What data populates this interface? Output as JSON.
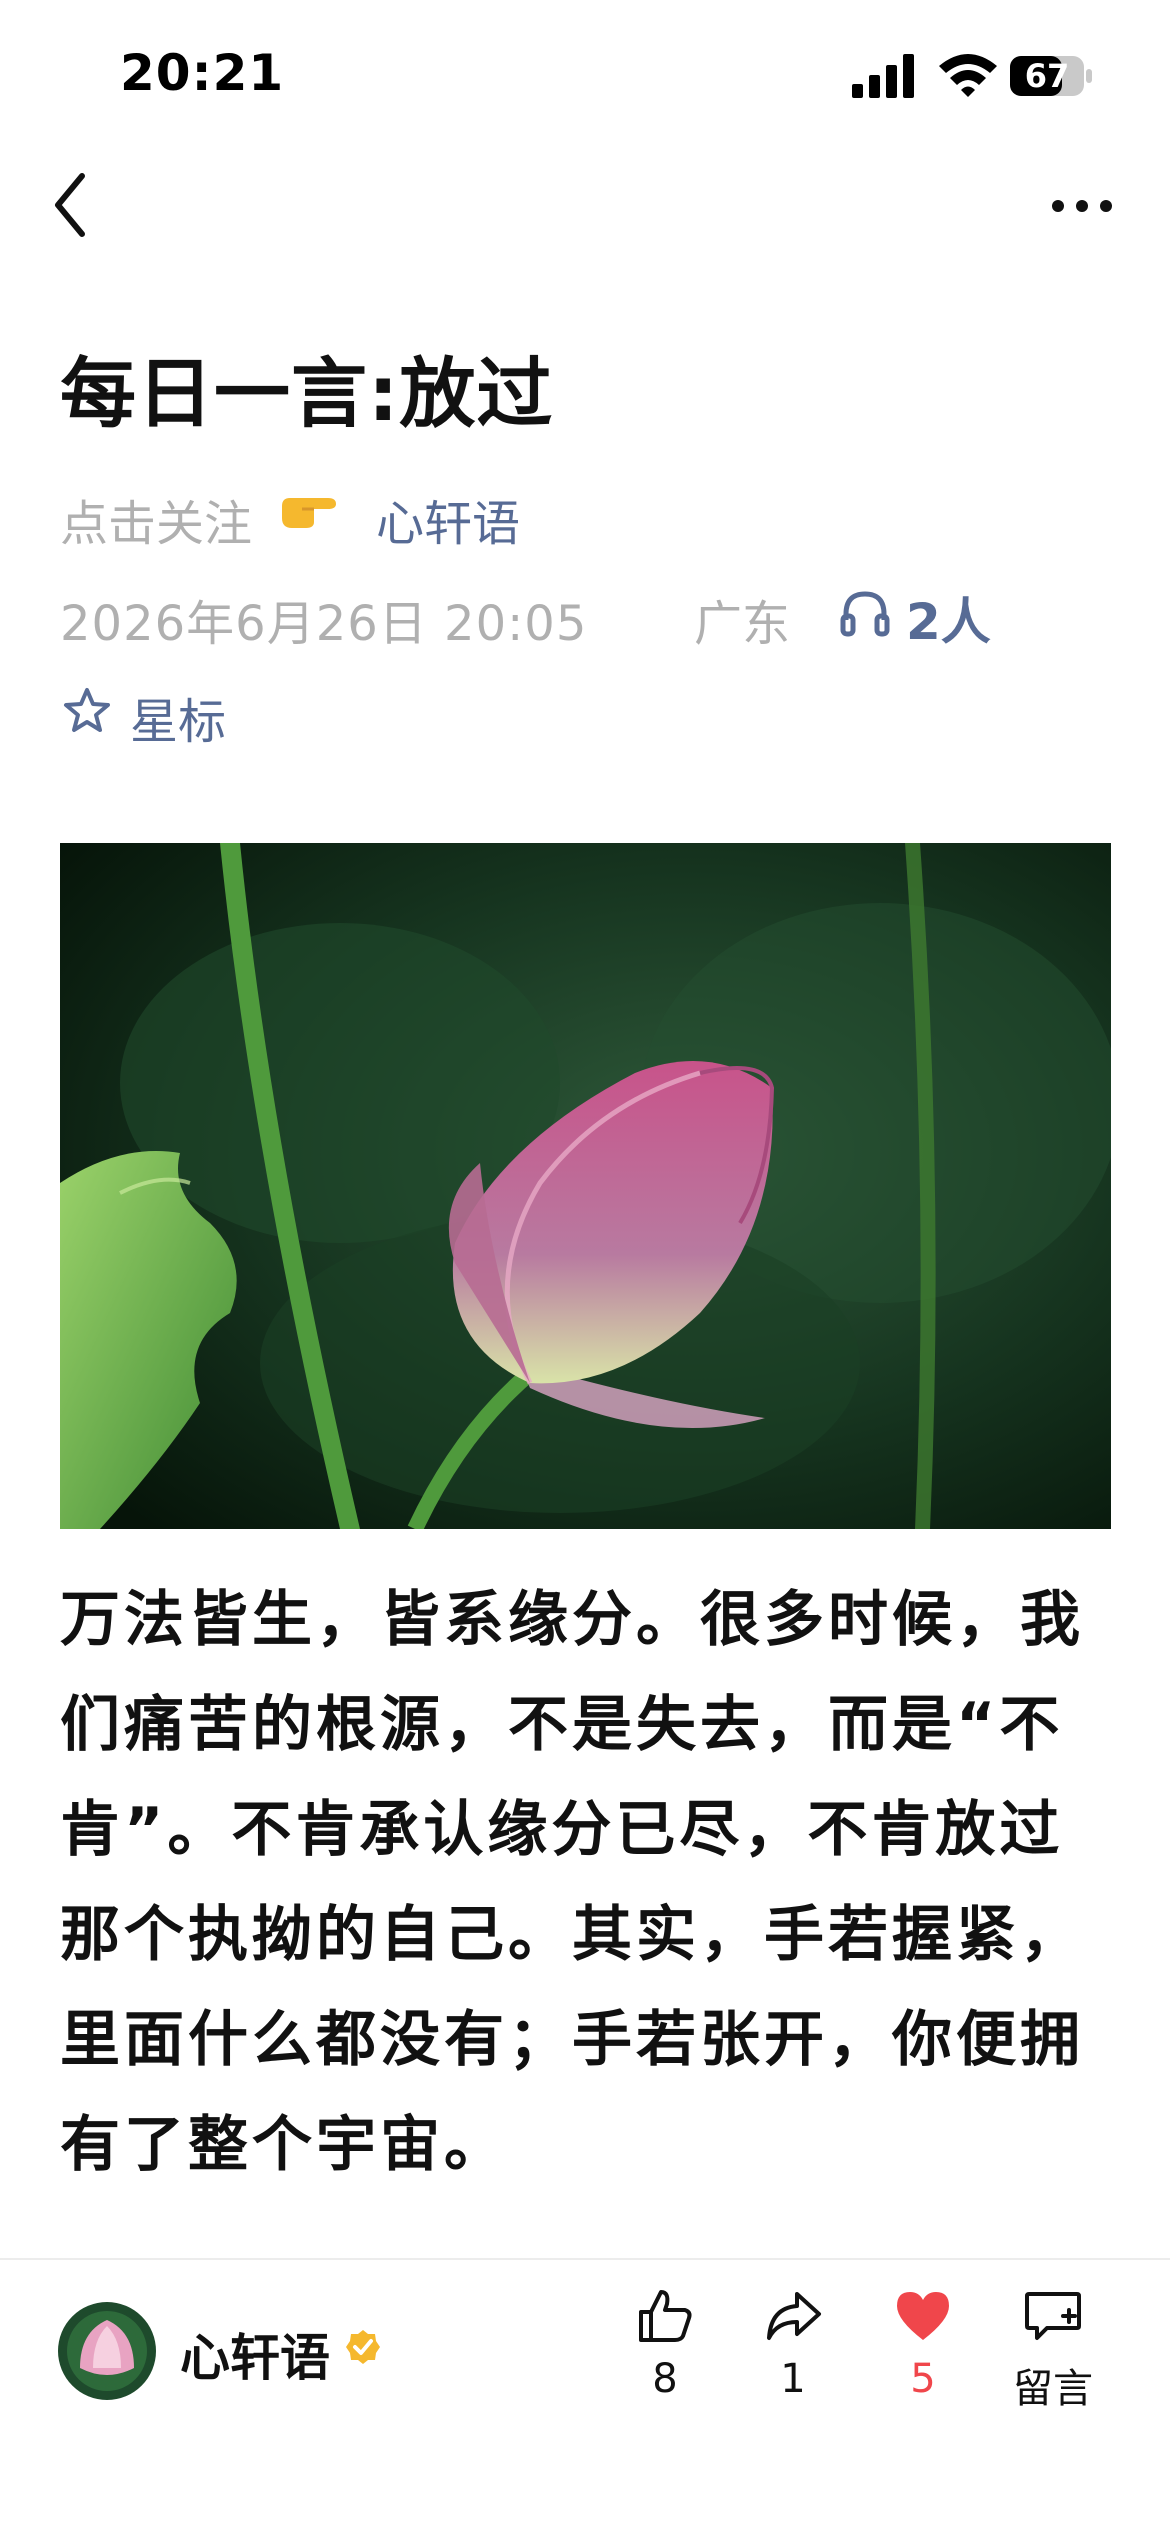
{
  "status_bar": {
    "time": "20:21",
    "battery": "67"
  },
  "article": {
    "title": "每日一言:放过",
    "follow_hint": "点击关注",
    "author": "心轩语",
    "date": "2026年6月26日 20:05",
    "region": "广东",
    "listeners": "2人",
    "star_label": "星标",
    "body": "万法皆生，皆系缘分。很多时候，我们痛苦的根源，不是失去，而是“不肯”。不肯承认缘分已尽，不肯放过那个执拗的自己。其实，手若握紧，里面什么都没有；手若张开，你便拥有了整个宇宙。"
  },
  "bottom_bar": {
    "name": "心轩语",
    "like_count": "8",
    "share_count": "1",
    "heart_count": "5",
    "comment_label": "留言"
  },
  "colors": {
    "link_blue": "#576b95",
    "meta_gray": "#b0b0b0",
    "heart_red": "#f0464b",
    "verified_gold": "#f5b82e"
  }
}
